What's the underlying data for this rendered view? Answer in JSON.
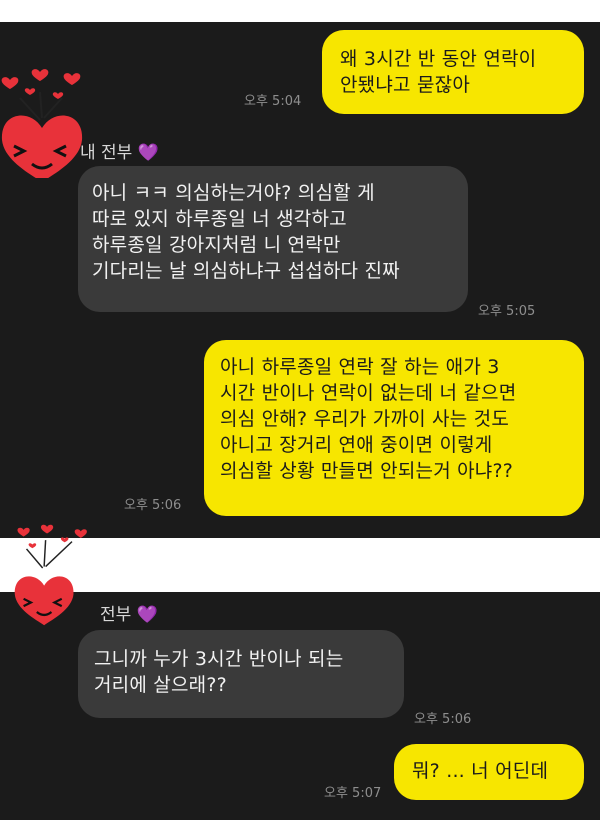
{
  "chat": {
    "messages": [
      {
        "sender": "me",
        "text": "왜 3시간 반 동안 연락이\n안됐냐고 묻잖아",
        "time": "오후 5:04"
      },
      {
        "sender": "them",
        "name": "내 전부",
        "text": "아니 ㅋㅋ 의심하는거야? 의심할 게\n따로 있지 하루종일 너 생각하고\n하루종일 강아지처럼 니 연락만\n기다리는 날 의심하냐구 섭섭하다 진짜",
        "time": "오후 5:05"
      },
      {
        "sender": "me",
        "text": "아니 하루종일 연락 잘 하는 애가 3\n시간 반이나 연락이 없는데 너 같으면\n의심 안해? 우리가 가까이 사는 것도\n아니고 장거리 연애 중이면 이렇게\n의심할 상황 만들면 안되는거 아냐??",
        "time": "오후 5:06"
      },
      {
        "sender": "them",
        "name": "전부",
        "text": "그니까 누가 3시간 반이나 되는\n거리에 살으래??",
        "time": "오후 5:06"
      },
      {
        "sender": "me",
        "text": "뭐? ... 너 어딘데",
        "time": "오후 5:07"
      }
    ],
    "heart_symbol": "💜",
    "colors": {
      "my_bubble": "#f7e600",
      "their_bubble": "#3a3a3a",
      "background": "#1b1b1b",
      "sticker_heart": "#e8323a"
    },
    "stickers": [
      "heart-face-sticker",
      "heart-face-sticker"
    ]
  }
}
